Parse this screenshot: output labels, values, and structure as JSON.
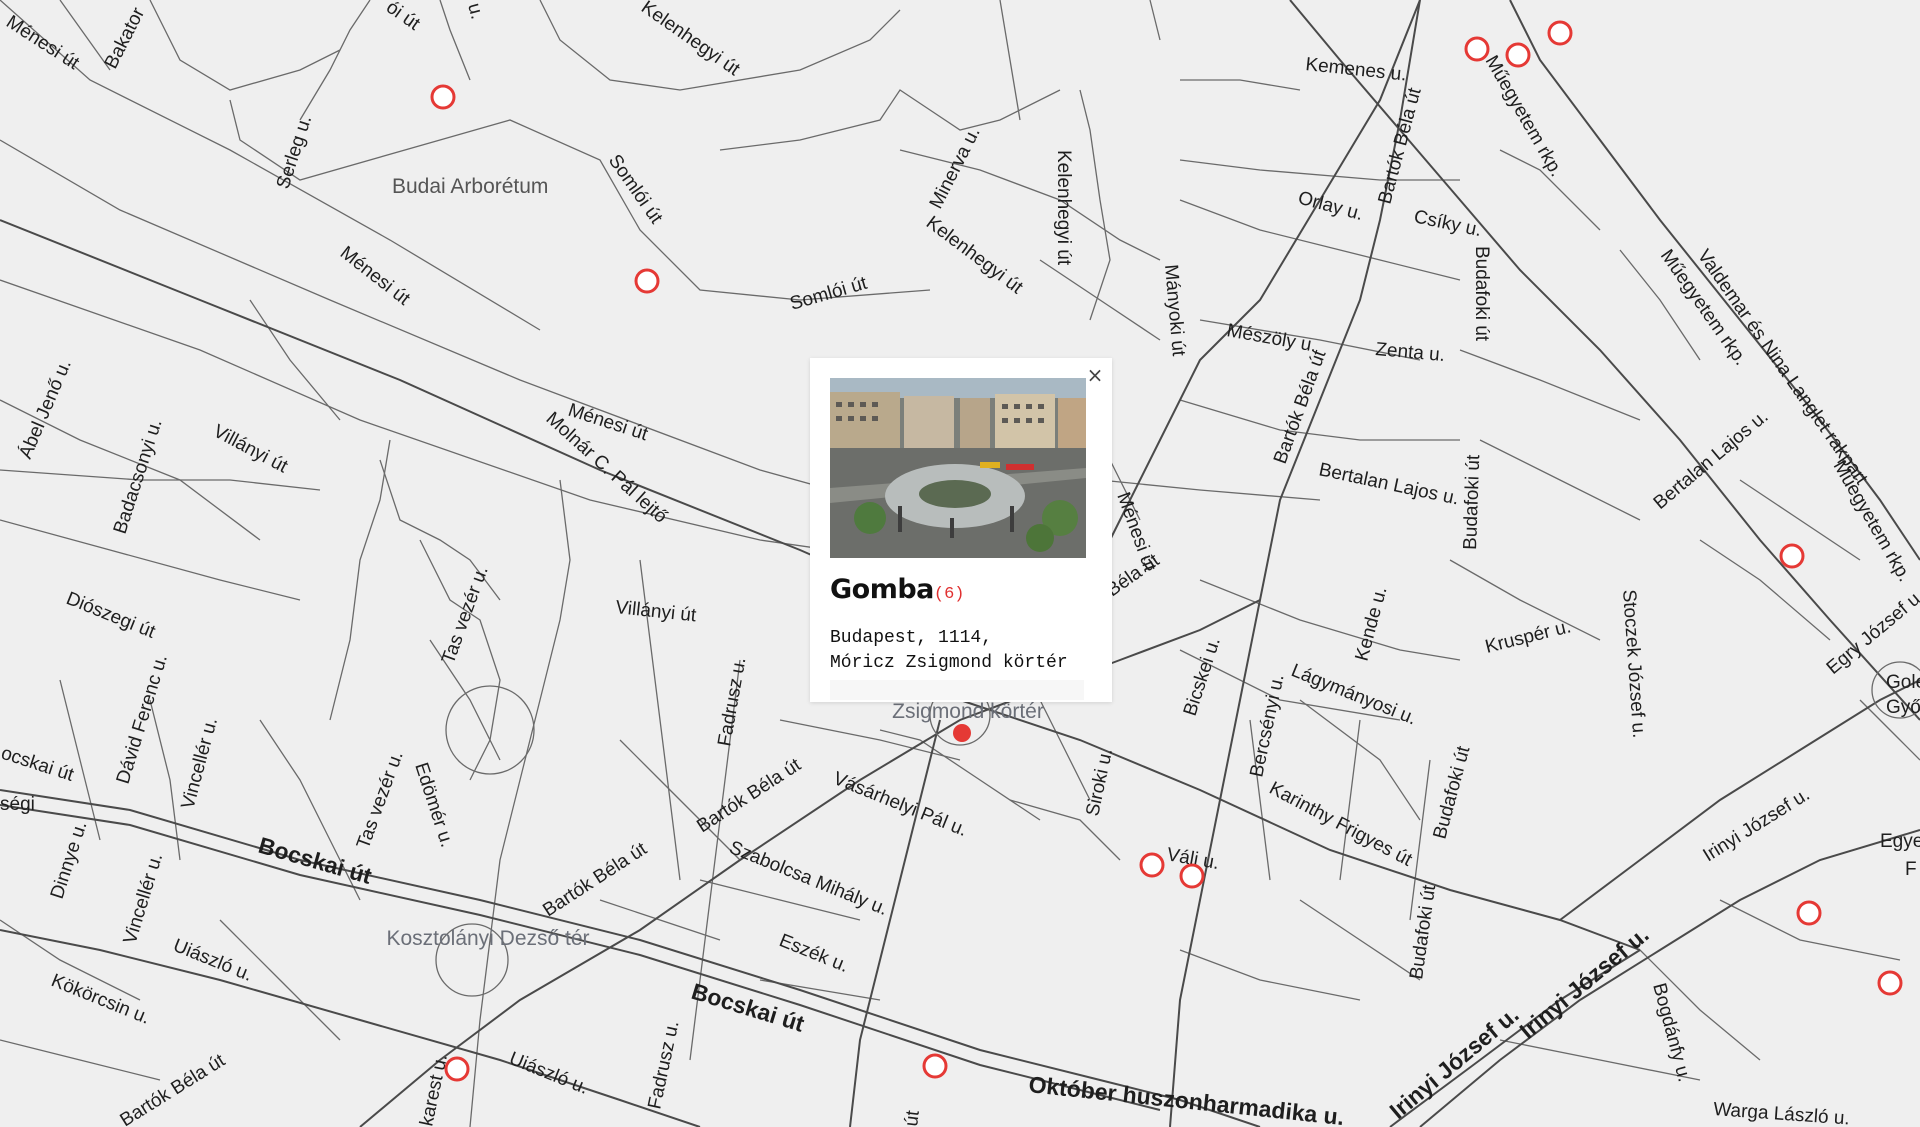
{
  "map": {
    "streets": [
      "Ménesi út",
      "Bakator",
      "ói út",
      "u.",
      "Kelenhegyi út",
      "Kemenes u.",
      "Műegyetem rkp.",
      "Serleg u.",
      "Budai Arborétum",
      "Somlói út",
      "Minerva u.",
      "Kelenhegyi út",
      "Kelenhegyi út",
      "Bartók Béla út",
      "Orlay u.",
      "Csíky u.",
      "Ménesi út",
      "Somlói út",
      "Mányoki út",
      "Mészöly u.",
      "Zenta u.",
      "Budafoki út",
      "Műegyetem rkp.",
      "Valdemar és Nina Langlet rakpart",
      "Ábel Jenő u.",
      "Ménesi út",
      "Molnár C. Pál lejtő",
      "Badacsonyi u.",
      "Villányi út",
      "Bartók Béla út",
      "Bertalan Lajos u.",
      "Budafoki út",
      "Bertalan Lajos u.",
      "Műegyetem rkp.",
      "Ménesi út",
      "Diószegi út",
      "Villányi út",
      "Tas vezér u.",
      "Béla út",
      "Kende u.",
      "Kruspér u.",
      "Stoczek József u.",
      "Egry József u.",
      "Dávid Ferenc u.",
      "Vincellér u.",
      "Fadrusz u.",
      "Bicskei u.",
      "Lágymányosi u.",
      "Bercsényi u.",
      "Gole",
      "Győ",
      "ocskai út",
      "ségi",
      "Bartók Béla út",
      "Tas vezér u.",
      "Edömér u.",
      "Vásárhelyi Pál u.",
      "Siroki u.",
      "Karinthy Frigyes út",
      "Budafoki út",
      "Irinyi József u.",
      "Egye",
      "F",
      "Dinnye u.",
      "Bocskai út",
      "Szabolcsa Mihály u.",
      "Váli u.",
      "Vincellér u.",
      "Bartók Béla út",
      "Budafoki út",
      "Kosztolányi Dezső tér",
      "Uiászló u.",
      "Eszék u.",
      "Kökörcsin u.",
      "Bocskai út",
      "Irinyi József u.",
      "Irinyi József u.",
      "Bogdánfy u.",
      "Fadrusz u.",
      "Uiászló u.",
      "Október huszonharmadika u.",
      "Bartók Béla út",
      "karest u.",
      "út",
      "Warga László u.",
      "Zsigmond körtér"
    ],
    "marker_color": "#e53935"
  },
  "popup": {
    "name": "Gomba",
    "count": "(6)",
    "address": "Budapest, 1114,\nMóricz Zsigmond körtér",
    "close_label": "×"
  }
}
